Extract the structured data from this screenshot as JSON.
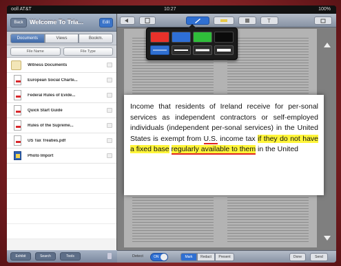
{
  "status": {
    "carrier": "ooll AT&T",
    "time": "10:27",
    "battery": "100%"
  },
  "sidebar": {
    "back_label": "Back",
    "title": "Welcome To Tria...",
    "edit_label": "Edit",
    "segments": [
      "Documents",
      "Views",
      "Bookm."
    ],
    "sort": [
      "File Name",
      "File Type"
    ],
    "files": [
      {
        "name": "Witness Documents",
        "icon": "folder-icon"
      },
      {
        "name": "European Social Charte...",
        "icon": "pdf-icon"
      },
      {
        "name": "Federal Rules of Evide...",
        "icon": "pdf-icon"
      },
      {
        "name": "Quick Start Guide",
        "icon": "pdf-icon"
      },
      {
        "name": "Rules of the Supreme...",
        "icon": "pdf-icon"
      },
      {
        "name": "US Tax Treaties.pdf",
        "icon": "pdf-icon"
      },
      {
        "name": "Photo Import",
        "icon": "image-icon"
      }
    ],
    "bottom": [
      "Exhibit",
      "Search",
      "Tools"
    ]
  },
  "toolbar": {
    "buttons": [
      "Back",
      "Page",
      "Pen",
      "Highlight",
      "Stamp",
      "Text",
      "Share"
    ]
  },
  "color_picker": {
    "colors": [
      "#e8312a",
      "#2e6fd6",
      "#2fbd3a",
      "#0b0b0b"
    ],
    "widths": [
      "thin",
      "medium",
      "thick",
      "extra"
    ]
  },
  "zoom_text": {
    "part1": "Income that residents of Ireland receive for per-sonal services as independent contractors or self-employed individuals (independent per-sonal services) in the United States is exempt from ",
    "us": "U.S.",
    "part2": " income tax ",
    "hl1": "if they do not have a fixed base",
    "sp": " ",
    "hl2": "regularly available to them",
    "part3": " in the United"
  },
  "bottom_bar": {
    "label": "Detect",
    "toggle": "ON",
    "segs": [
      "Mark",
      "Redact",
      "Present"
    ],
    "right": [
      "Done",
      "Send"
    ]
  }
}
